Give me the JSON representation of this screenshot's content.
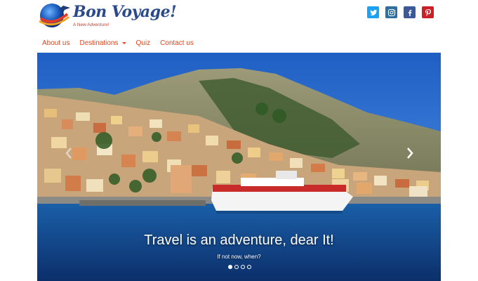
{
  "brand": {
    "title": "Bon Voyage!",
    "tagline": "A New Adventure!"
  },
  "social": [
    {
      "name": "twitter",
      "icon": "twitter-icon",
      "color": "#1da1f2"
    },
    {
      "name": "instagram",
      "icon": "instagram-icon",
      "color": "#2e6f9e"
    },
    {
      "name": "facebook",
      "icon": "facebook-icon",
      "color": "#3b5998"
    },
    {
      "name": "pinterest",
      "icon": "pinterest-icon",
      "color": "#cb2027"
    }
  ],
  "nav": {
    "about": "About us",
    "destinations": "Destinations",
    "quiz": "Quiz",
    "contact": "Contact us"
  },
  "carousel": {
    "title": "Travel is an adventure, dear It!",
    "subtitle": "If not now, when?",
    "prev_icon": "chevron-left-icon",
    "next_icon": "chevron-right-icon",
    "slides": 4,
    "active_slide": 1
  },
  "colors": {
    "accent": "#e2461d",
    "brand_blue": "#2a4a8c"
  }
}
